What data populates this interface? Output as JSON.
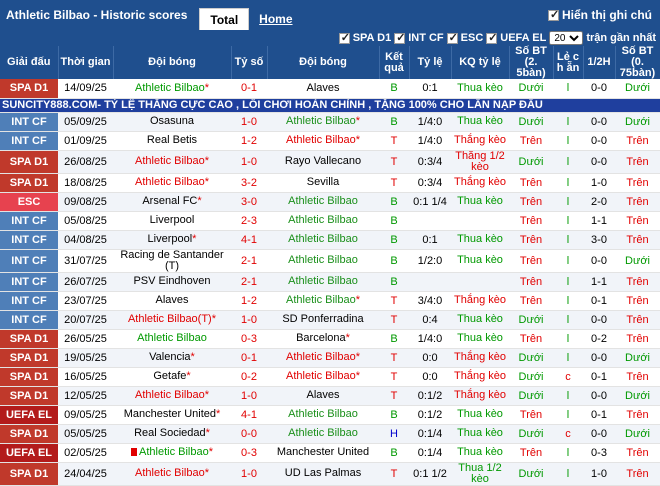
{
  "header": {
    "title": "Athletic Bilbao - Historic scores",
    "tab_total": "Total",
    "tab_home": "Home",
    "show_comments": "Hiển thị ghi chú"
  },
  "filters": {
    "items": [
      "SPA D1",
      "INT CF",
      "ESC",
      "UEFA EL"
    ],
    "count": "20",
    "suffix": "trận gần nhất"
  },
  "columns": [
    "Giải đấu",
    "Thời gian",
    "Đội bóng",
    "Tỷ số",
    "Đội bóng",
    "Kết quả",
    "Tỷ lệ",
    "KQ tỷ lệ",
    "Số BT (2. 5bàn)",
    "Lẻ c h ẵn",
    "1/2H",
    "Số BT (0. 75bàn)"
  ],
  "banner": "SUNCITY888.COM- TỶ LỆ THẮNG CỰC CAO , LỐI CHƠI HOÀN CHỈNH , TẶNG 100% CHO LẦN NẠP ĐẦU",
  "colors": {
    "header": "#1f4f8e",
    "spa": "#c0392b",
    "intcf": "#4f7fb8",
    "esc": "#e7424f",
    "uefa": "#b31b1b",
    "win": "#e10000",
    "draw": "#1a8f1a",
    "lose": "#0000cc"
  },
  "rows": [
    {
      "comp": "SPA D1",
      "cls": "spa",
      "date": "14/09/25",
      "home": "Athletic Bilbao",
      "home_star": true,
      "home_ath": true,
      "score": "0-1",
      "away": "Alaves",
      "away_star": false,
      "away_ath": false,
      "result": "B",
      "res_cls": "green",
      "odds": "0:1",
      "kq": "Thua kèo",
      "kq_cls": "green",
      "bt25": "Dưới",
      "bt25_cls": "green",
      "oe": "l",
      "h1": "0-0",
      "bt075": "Dưới",
      "bt075_cls": "green",
      "home_cls": "green"
    },
    {
      "comp": "INT CF",
      "cls": "intcf",
      "date": "05/09/25",
      "home": "Osasuna",
      "home_star": false,
      "home_ath": false,
      "score": "1-0",
      "away": "Athletic Bilbao",
      "away_star": true,
      "away_ath": true,
      "result": "B",
      "res_cls": "green",
      "odds": "1/4:0",
      "kq": "Thua kèo",
      "kq_cls": "green",
      "bt25": "Dưới",
      "bt25_cls": "green",
      "oe": "l",
      "h1": "0-0",
      "bt075": "Dưới",
      "bt075_cls": "green"
    },
    {
      "comp": "INT CF",
      "cls": "intcf",
      "date": "01/09/25",
      "home": "Real Betis",
      "home_star": false,
      "home_ath": false,
      "score": "1-2",
      "away": "Athletic Bilbao",
      "away_star": true,
      "away_ath": true,
      "result": "T",
      "res_cls": "red",
      "odds": "1/4:0",
      "kq": "Thắng kèo",
      "kq_cls": "red",
      "bt25": "Trên",
      "bt25_cls": "red",
      "oe": "l",
      "h1": "0-0",
      "bt075": "Trên",
      "bt075_cls": "red",
      "away_cls": "red"
    },
    {
      "comp": "SPA D1",
      "cls": "spa",
      "date": "26/08/25",
      "home": "Athletic Bilbao",
      "home_star": true,
      "home_ath": true,
      "score": "1-0",
      "away": "Rayo Vallecano",
      "away_star": false,
      "away_ath": false,
      "result": "T",
      "res_cls": "red",
      "odds": "0:3/4",
      "kq": "Thắng 1/2 kèo",
      "kq_cls": "red",
      "bt25": "Dưới",
      "bt25_cls": "green",
      "oe": "l",
      "h1": "0-0",
      "bt075": "Trên",
      "bt075_cls": "red",
      "home_cls": "red"
    },
    {
      "comp": "SPA D1",
      "cls": "spa",
      "date": "18/08/25",
      "home": "Athletic Bilbao",
      "home_star": true,
      "home_ath": true,
      "score": "3-2",
      "away": "Sevilla",
      "away_star": false,
      "away_ath": false,
      "result": "T",
      "res_cls": "red",
      "odds": "0:3/4",
      "kq": "Thắng kèo",
      "kq_cls": "red",
      "bt25": "Trên",
      "bt25_cls": "red",
      "oe": "l",
      "h1": "1-0",
      "bt075": "Trên",
      "bt075_cls": "red",
      "home_cls": "red"
    },
    {
      "comp": "ESC",
      "cls": "esc",
      "date": "09/08/25",
      "home": "Arsenal FC",
      "home_star": true,
      "home_ath": false,
      "score": "3-0",
      "away": "Athletic Bilbao",
      "away_star": false,
      "away_ath": true,
      "result": "B",
      "res_cls": "green",
      "odds": "0:1 1/4",
      "kq": "Thua kèo",
      "kq_cls": "green",
      "bt25": "Trên",
      "bt25_cls": "red",
      "oe": "l",
      "h1": "2-0",
      "bt075": "Trên",
      "bt075_cls": "red"
    },
    {
      "comp": "INT CF",
      "cls": "intcf",
      "date": "05/08/25",
      "home": "Liverpool",
      "home_star": false,
      "home_ath": false,
      "score": "2-3",
      "away": "Athletic Bilbao",
      "away_star": false,
      "away_ath": true,
      "result": "B",
      "res_cls": "green",
      "odds": "",
      "kq": "",
      "kq_cls": "green",
      "bt25": "Trên",
      "bt25_cls": "red",
      "oe": "l",
      "h1": "1-1",
      "bt075": "Trên",
      "bt075_cls": "red"
    },
    {
      "comp": "INT CF",
      "cls": "intcf",
      "date": "04/08/25",
      "home": "Liverpool",
      "home_star": true,
      "home_ath": false,
      "score": "4-1",
      "away": "Athletic Bilbao",
      "away_star": false,
      "away_ath": true,
      "result": "B",
      "res_cls": "green",
      "odds": "0:1",
      "kq": "Thua kèo",
      "kq_cls": "green",
      "bt25": "Trên",
      "bt25_cls": "red",
      "oe": "l",
      "h1": "3-0",
      "bt075": "Trên",
      "bt075_cls": "red"
    },
    {
      "comp": "INT CF",
      "cls": "intcf",
      "date": "31/07/25",
      "home": "Racing de Santander (T)",
      "home_star": false,
      "home_ath": false,
      "score": "2-1",
      "away": "Athletic Bilbao",
      "away_star": false,
      "away_ath": true,
      "result": "B",
      "res_cls": "green",
      "odds": "1/2:0",
      "kq": "Thua kèo",
      "kq_cls": "green",
      "bt25": "Trên",
      "bt25_cls": "red",
      "oe": "l",
      "h1": "0-0",
      "bt075": "Dưới",
      "bt075_cls": "green"
    },
    {
      "comp": "INT CF",
      "cls": "intcf",
      "date": "26/07/25",
      "home": "PSV Eindhoven",
      "home_star": false,
      "home_ath": false,
      "score": "2-1",
      "away": "Athletic Bilbao",
      "away_star": false,
      "away_ath": true,
      "result": "B",
      "res_cls": "green",
      "odds": "",
      "kq": "",
      "kq_cls": "green",
      "bt25": "Trên",
      "bt25_cls": "red",
      "oe": "l",
      "h1": "1-1",
      "bt075": "Trên",
      "bt075_cls": "red"
    },
    {
      "comp": "INT CF",
      "cls": "intcf",
      "date": "23/07/25",
      "home": "Alaves",
      "home_star": false,
      "home_ath": false,
      "score": "1-2",
      "away": "Athletic Bilbao",
      "away_star": true,
      "away_ath": true,
      "result": "T",
      "res_cls": "red",
      "odds": "3/4:0",
      "kq": "Thắng kèo",
      "kq_cls": "red",
      "bt25": "Trên",
      "bt25_cls": "red",
      "oe": "l",
      "h1": "0-1",
      "bt075": "Trên",
      "bt075_cls": "red"
    },
    {
      "comp": "INT CF",
      "cls": "intcf",
      "date": "20/07/25",
      "home": "Athletic Bilbao(T)",
      "home_star": true,
      "home_ath": true,
      "score": "1-0",
      "away": "SD Ponferradina",
      "away_star": false,
      "away_ath": false,
      "result": "T",
      "res_cls": "red",
      "odds": "0:4",
      "kq": "Thua kèo",
      "kq_cls": "green",
      "bt25": "Dưới",
      "bt25_cls": "green",
      "oe": "l",
      "h1": "0-0",
      "bt075": "Trên",
      "bt075_cls": "red",
      "home_cls": "red"
    },
    {
      "comp": "SPA D1",
      "cls": "spa",
      "date": "26/05/25",
      "home": "Athletic Bilbao",
      "home_star": false,
      "home_ath": true,
      "score": "0-3",
      "away": "Barcelona",
      "away_star": true,
      "away_ath": false,
      "result": "B",
      "res_cls": "green",
      "odds": "1/4:0",
      "kq": "Thua kèo",
      "kq_cls": "green",
      "bt25": "Trên",
      "bt25_cls": "red",
      "oe": "l",
      "h1": "0-2",
      "bt075": "Trên",
      "bt075_cls": "red",
      "home_cls": "green"
    },
    {
      "comp": "SPA D1",
      "cls": "spa",
      "date": "19/05/25",
      "home": "Valencia",
      "home_star": true,
      "home_ath": false,
      "score": "0-1",
      "away": "Athletic Bilbao",
      "away_star": true,
      "away_ath": true,
      "result": "T",
      "res_cls": "red",
      "odds": "0:0",
      "kq": "Thắng kèo",
      "kq_cls": "red",
      "bt25": "Dưới",
      "bt25_cls": "green",
      "oe": "l",
      "h1": "0-0",
      "bt075": "Dưới",
      "bt075_cls": "green",
      "away_cls": "red"
    },
    {
      "comp": "SPA D1",
      "cls": "spa",
      "date": "16/05/25",
      "home": "Getafe",
      "home_star": true,
      "home_ath": false,
      "score": "0-2",
      "away": "Athletic Bilbao",
      "away_star": true,
      "away_ath": true,
      "result": "T",
      "res_cls": "red",
      "odds": "0:0",
      "kq": "Thắng kèo",
      "kq_cls": "red",
      "bt25": "Dưới",
      "bt25_cls": "green",
      "oe": "c",
      "h1": "0-1",
      "bt075": "Trên",
      "bt075_cls": "red",
      "away_cls": "red"
    },
    {
      "comp": "SPA D1",
      "cls": "spa",
      "date": "12/05/25",
      "home": "Athletic Bilbao",
      "home_star": true,
      "home_ath": true,
      "score": "1-0",
      "away": "Alaves",
      "away_star": false,
      "away_ath": false,
      "result": "T",
      "res_cls": "red",
      "odds": "0:1/2",
      "kq": "Thắng kèo",
      "kq_cls": "red",
      "bt25": "Dưới",
      "bt25_cls": "green",
      "oe": "l",
      "h1": "0-0",
      "bt075": "Dưới",
      "bt075_cls": "green",
      "home_cls": "red"
    },
    {
      "comp": "UEFA EL",
      "cls": "uefa",
      "date": "09/05/25",
      "home": "Manchester United",
      "home_star": true,
      "home_ath": false,
      "score": "4-1",
      "away": "Athletic Bilbao",
      "away_star": false,
      "away_ath": true,
      "result": "B",
      "res_cls": "green",
      "odds": "0:1/2",
      "kq": "Thua kèo",
      "kq_cls": "green",
      "bt25": "Trên",
      "bt25_cls": "red",
      "oe": "l",
      "h1": "0-1",
      "bt075": "Trên",
      "bt075_cls": "red"
    },
    {
      "comp": "SPA D1",
      "cls": "spa",
      "date": "05/05/25",
      "home": "Real Sociedad",
      "home_star": true,
      "home_ath": false,
      "score": "0-0",
      "away": "Athletic Bilbao",
      "away_star": false,
      "away_ath": true,
      "result": "H",
      "res_cls": "blue",
      "odds": "0:1/4",
      "kq": "Thua kèo",
      "kq_cls": "green",
      "bt25": "Dưới",
      "bt25_cls": "green",
      "oe": "c",
      "h1": "0-0",
      "bt075": "Dưới",
      "bt075_cls": "green"
    },
    {
      "comp": "UEFA EL",
      "cls": "uefa",
      "date": "02/05/25",
      "home": "Athletic Bilbao",
      "home_star": true,
      "home_ath": true,
      "home_card": true,
      "score": "0-3",
      "away": "Manchester United",
      "away_star": false,
      "away_ath": false,
      "result": "B",
      "res_cls": "green",
      "odds": "0:1/4",
      "kq": "Thua kèo",
      "kq_cls": "green",
      "bt25": "Trên",
      "bt25_cls": "red",
      "oe": "l",
      "h1": "0-3",
      "bt075": "Trên",
      "bt075_cls": "red",
      "home_cls": "green"
    },
    {
      "comp": "SPA D1",
      "cls": "spa",
      "date": "24/04/25",
      "home": "Athletic Bilbao",
      "home_star": true,
      "home_ath": true,
      "score": "1-0",
      "away": "UD Las Palmas",
      "away_star": false,
      "away_ath": false,
      "result": "T",
      "res_cls": "red",
      "odds": "0:1 1/2",
      "kq": "Thua 1/2 kèo",
      "kq_cls": "green",
      "bt25": "Dưới",
      "bt25_cls": "green",
      "oe": "l",
      "h1": "1-0",
      "bt075": "Trên",
      "bt075_cls": "red",
      "home_cls": "red"
    }
  ]
}
